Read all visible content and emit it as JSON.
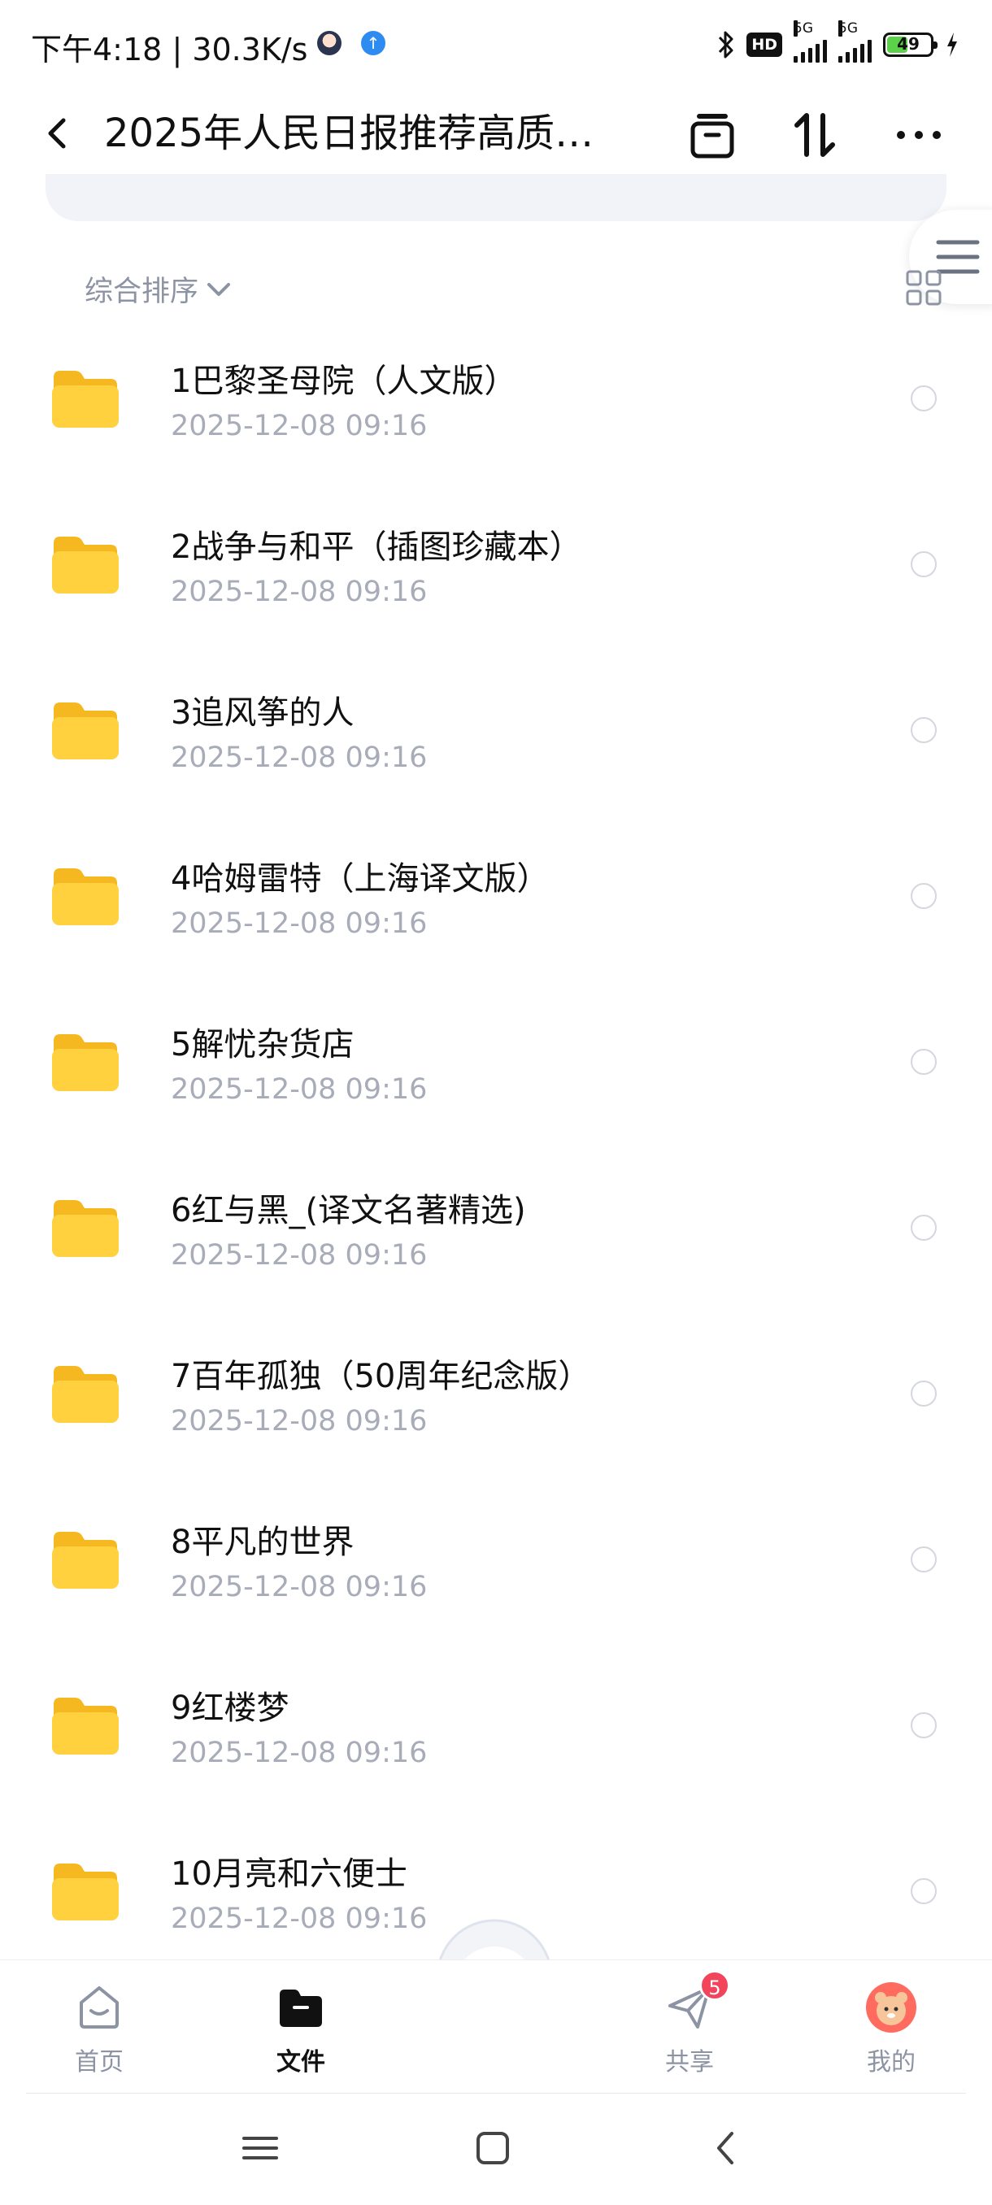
{
  "status_bar": {
    "time": "下午4:18",
    "speed": "30.3K/s",
    "hd_label": "HD",
    "signal1_label": "5G",
    "signal2_label": "5G",
    "battery_level": "49"
  },
  "header": {
    "title": "2025年人民日报推荐高质…"
  },
  "sort": {
    "label": "综合排序"
  },
  "files": [
    {
      "name": "1巴黎圣母院（人文版）",
      "date": "2025-12-08  09:16"
    },
    {
      "name": "2战争与和平（插图珍藏本）",
      "date": "2025-12-08  09:16"
    },
    {
      "name": "3追风筝的人",
      "date": "2025-12-08  09:16"
    },
    {
      "name": "4哈姆雷特（上海译文版）",
      "date": "2025-12-08  09:16"
    },
    {
      "name": "5解忧杂货店",
      "date": "2025-12-08  09:16"
    },
    {
      "name": "6红与黑_(译文名著精选)",
      "date": "2025-12-08  09:16"
    },
    {
      "name": "7百年孤独（50周年纪念版）",
      "date": "2025-12-08  09:16"
    },
    {
      "name": "8平凡的世界",
      "date": "2025-12-08  09:16"
    },
    {
      "name": "9红楼梦",
      "date": "2025-12-08  09:16"
    },
    {
      "name": "10月亮和六便士",
      "date": "2025-12-08  09:16"
    }
  ],
  "bottom_nav": {
    "home": "首页",
    "files": "文件",
    "share": "共享",
    "share_badge": "5",
    "mine": "我的"
  },
  "colors": {
    "folder": "#ffd13f",
    "muted_text": "#8c93a3",
    "badge": "#f2445a"
  }
}
